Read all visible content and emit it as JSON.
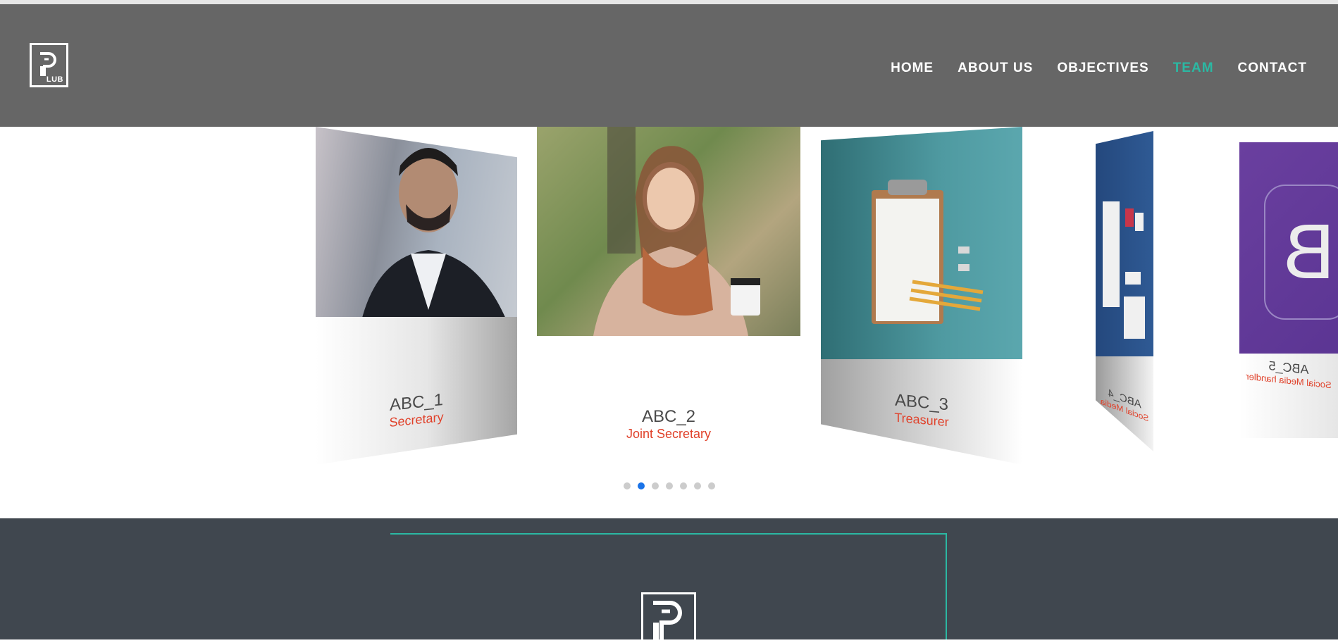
{
  "brand": {
    "logo_text": "LUB"
  },
  "nav": {
    "items": [
      {
        "label": "HOME",
        "active": false
      },
      {
        "label": "ABOUT US",
        "active": false
      },
      {
        "label": "OBJECTIVES",
        "active": false
      },
      {
        "label": "TEAM",
        "active": true
      },
      {
        "label": "CONTACT",
        "active": false
      }
    ]
  },
  "team": {
    "cards": [
      {
        "name": "ABC_1",
        "role": "Secretary"
      },
      {
        "name": "ABC_2",
        "role": "Joint Secretary"
      },
      {
        "name": "ABC_3",
        "role": "Treasurer"
      },
      {
        "name": "ABC_4",
        "role": "Social Media"
      },
      {
        "name": "ABC_5",
        "role": "Social Media handler"
      }
    ],
    "dots": {
      "count": 7,
      "active_index": 1
    }
  },
  "colors": {
    "header_bg": "#666666",
    "accent": "#2bb8a3",
    "role_text": "#e0412a",
    "footer_bg": "#40474f",
    "dot_active": "#1a73e8"
  }
}
